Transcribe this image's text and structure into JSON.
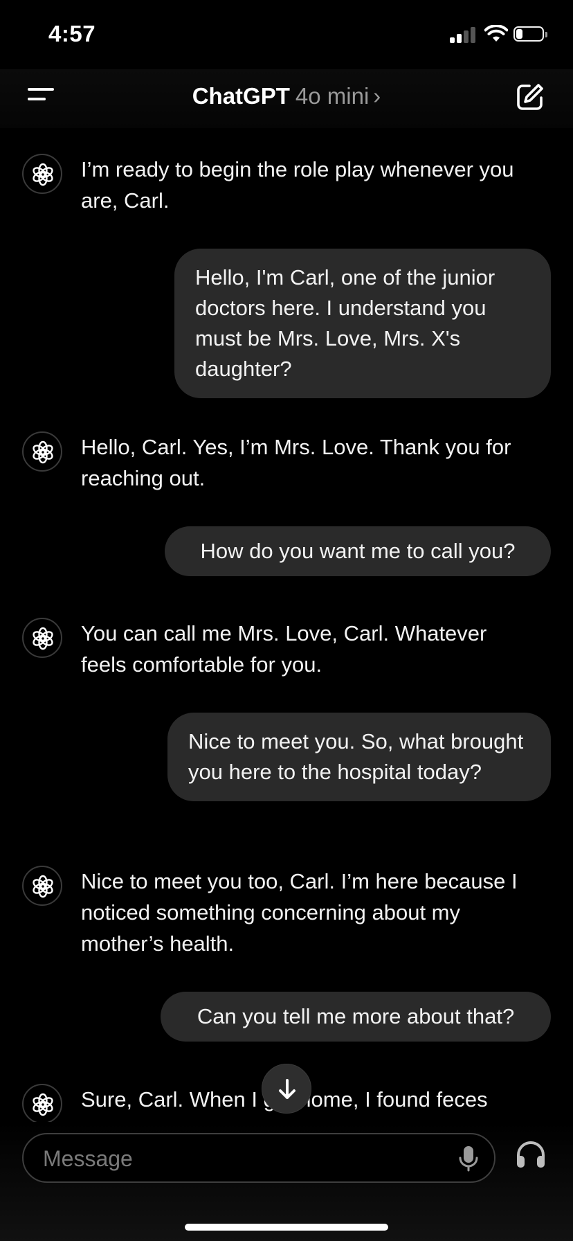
{
  "status_bar": {
    "time": "4:57",
    "icons": [
      "cellular-signal-icon",
      "wifi-icon",
      "battery-icon"
    ]
  },
  "header": {
    "menu_icon": "menu-icon",
    "title": "ChatGPT",
    "model": "4o mini",
    "chevron": "›",
    "edit_icon": "new-chat-icon"
  },
  "messages": [
    {
      "role": "assistant",
      "text": "I’m ready to begin the role play whenever you are, Carl."
    },
    {
      "role": "user",
      "text": "Hello, I'm Carl, one of the junior doctors here. I understand you must be Mrs. Love, Mrs. X's daughter?"
    },
    {
      "role": "assistant",
      "text": "Hello, Carl. Yes, I’m Mrs. Love. Thank you for reaching out."
    },
    {
      "role": "user",
      "text": "How do you want me to call you?"
    },
    {
      "role": "assistant",
      "text": "You can call me Mrs. Love, Carl. Whatever feels comfortable for you."
    },
    {
      "role": "user",
      "text": "Nice to meet you. So, what brought you here to the hospital today?"
    },
    {
      "role": "assistant",
      "text": "Nice to meet you too, Carl. I’m here because I noticed something concerning about my mother’s health."
    },
    {
      "role": "user",
      "text": "Can you tell me more about that?"
    },
    {
      "role": "assistant",
      "text": "Sure, Carl. When I got home, I found feces"
    }
  ],
  "composer": {
    "placeholder": "Message",
    "mic_icon": "microphone-icon",
    "voice_icon": "headphones-icon"
  },
  "colors": {
    "background": "#000000",
    "user_bubble": "#2a2a2a",
    "muted_text": "#9a9a9a"
  }
}
